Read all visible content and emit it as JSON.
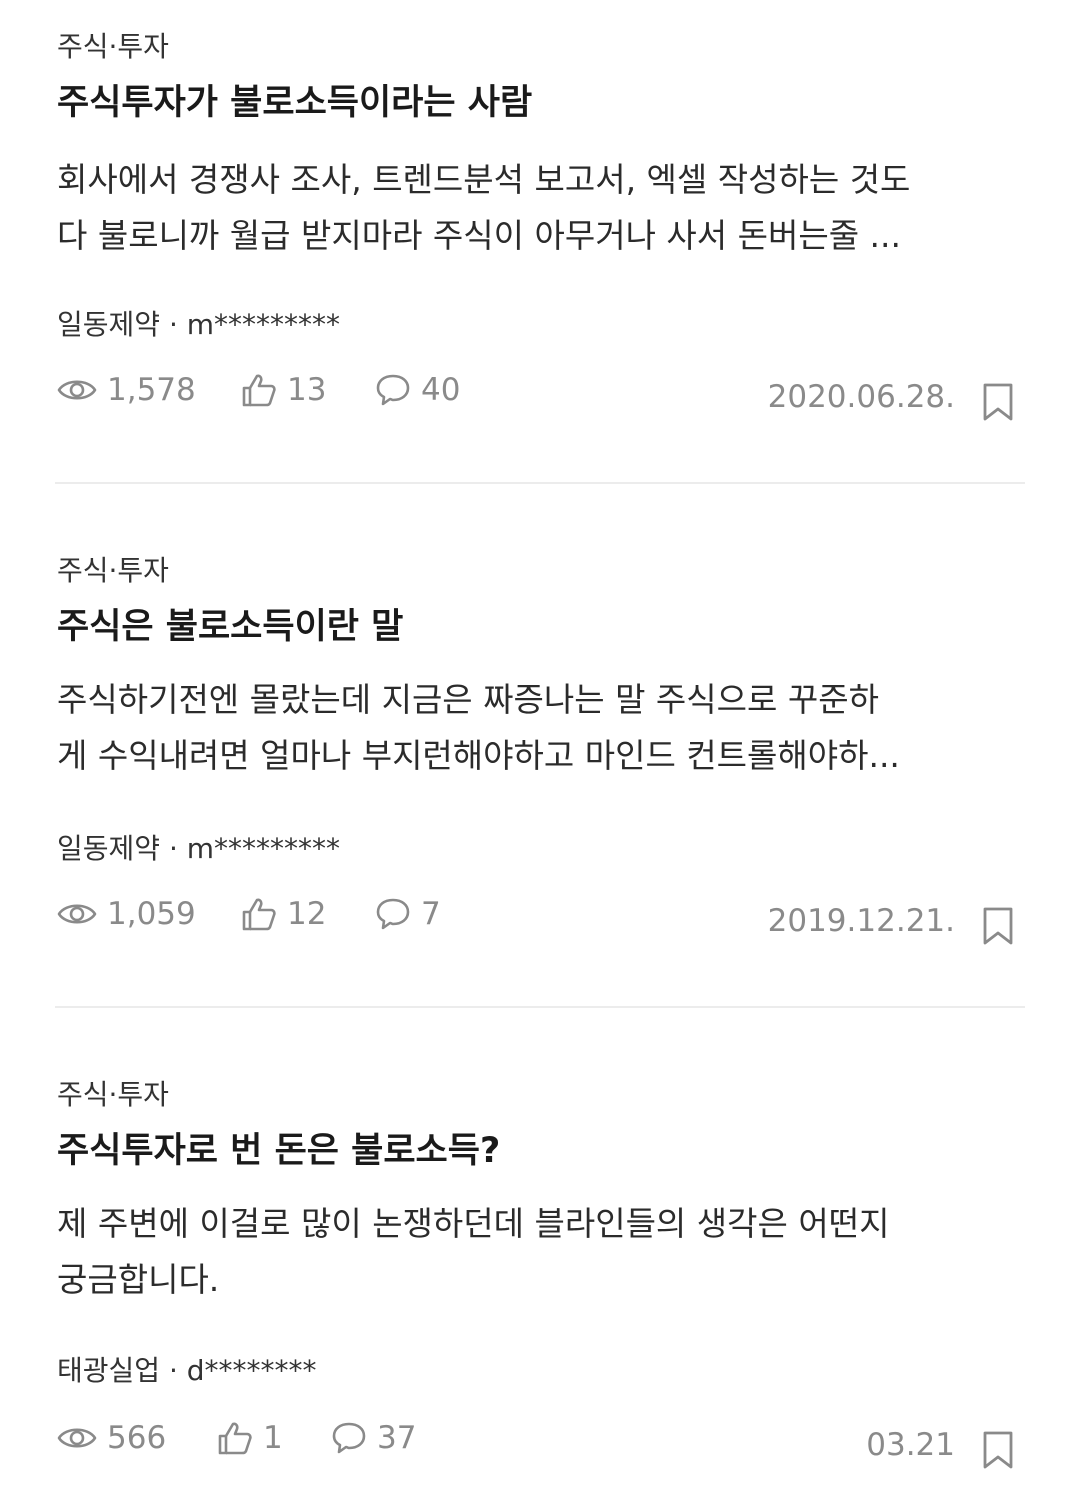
{
  "colors": {
    "text_primary": "#1a1a1a",
    "text_secondary": "#333333",
    "meta_gray": "#8a8a8a",
    "divider": "#ececec"
  },
  "icons": {
    "views": "eye-icon",
    "likes": "thumbs-up-icon",
    "comments": "speech-bubble-icon",
    "save": "bookmark-icon"
  },
  "posts": [
    {
      "category": "주식·투자",
      "title": "주식투자가 불로소득이라는 사람",
      "excerpt_lines": [
        "회사에서 경쟁사 조사, 트렌드분석 보고서, 엑셀 작성하는 것도",
        "다 불로니까 월급 받지마라 주식이 아무거나 사서 돈버는줄 ..."
      ],
      "author": "일동제약 · m*********",
      "views": "1,578",
      "likes": "13",
      "comments": "40",
      "date": "2020.06.28."
    },
    {
      "category": "주식·투자",
      "title": "주식은 불로소득이란 말",
      "excerpt_lines": [
        "주식하기전엔 몰랐는데 지금은 짜증나는 말 주식으로 꾸준하",
        "게 수익내려면 얼마나 부지런해야하고 마인드 컨트롤해야하..."
      ],
      "author": "일동제약 · m*********",
      "views": "1,059",
      "likes": "12",
      "comments": "7",
      "date": "2019.12.21."
    },
    {
      "category": "주식·투자",
      "title": "주식투자로 번 돈은 불로소득?",
      "excerpt_lines": [
        "제 주변에 이걸로 많이 논쟁하던데 블라인들의 생각은 어떤지",
        "궁금합니다."
      ],
      "author": "태광실업 · d********",
      "views": "566",
      "likes": "1",
      "comments": "37",
      "date": "03.21"
    }
  ]
}
